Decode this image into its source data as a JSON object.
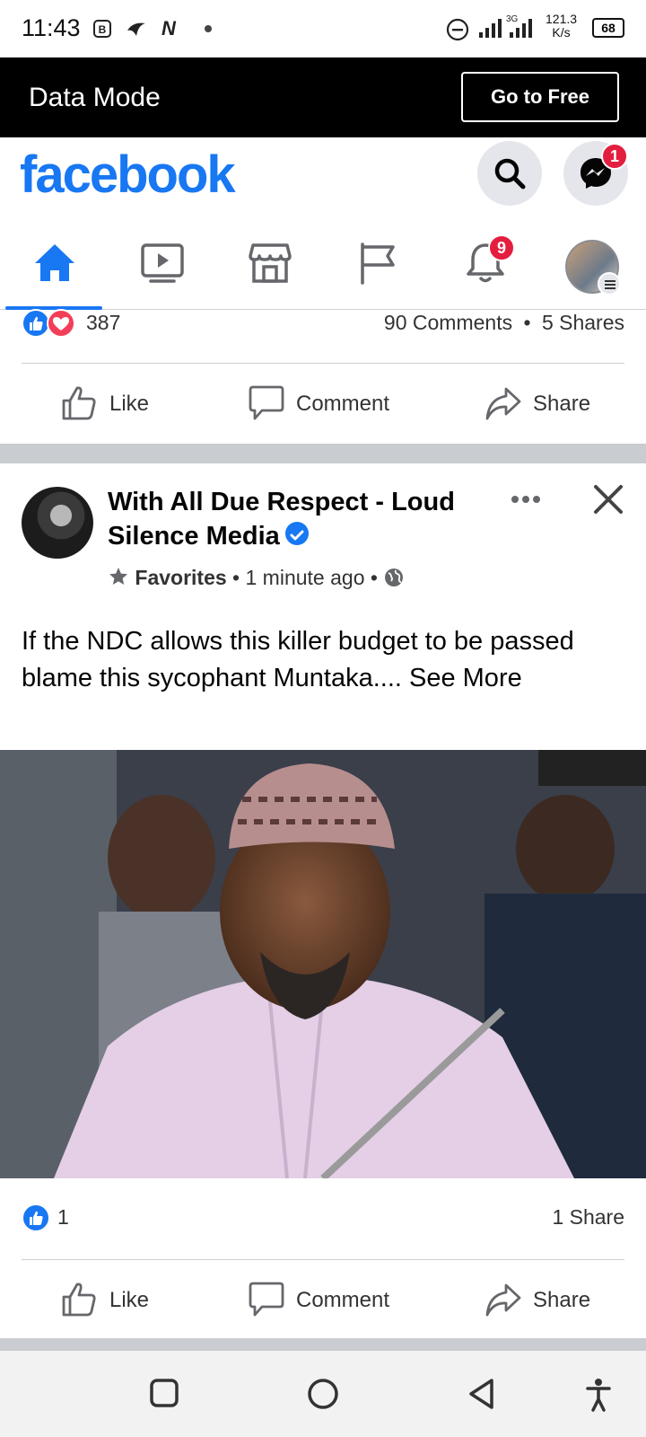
{
  "status_bar": {
    "time": "11:43",
    "speed": "121.3",
    "speed_unit": "K/s",
    "battery": "68",
    "network_label": "3G"
  },
  "data_banner": {
    "title": "Data Mode",
    "button_label": "Go to Free"
  },
  "header": {
    "logo": "facebook",
    "messenger_badge": "1"
  },
  "nav_tabs": {
    "active": "home",
    "notifications_badge": "9",
    "items": [
      "home-icon",
      "video-icon",
      "marketplace-icon",
      "pages-flag-icon",
      "notifications-bell-icon",
      "profile-menu"
    ]
  },
  "prev_post": {
    "reaction_count": "387",
    "comments": "90 Comments",
    "shares": "5 Shares",
    "dot": "•"
  },
  "actions": {
    "like": "Like",
    "comment": "Comment",
    "share": "Share"
  },
  "post": {
    "author": "With All Due Respect - Loud Silence Media",
    "verified": true,
    "favorites_label": "Favorites",
    "dot": "•",
    "time": "1 minute ago",
    "text": "If the NDC allows this killer budget to be passed blame this sycophant Muntaka.... See More",
    "reaction_count": "1",
    "shares": "1 Share"
  },
  "colors": {
    "brand": "#1877f2",
    "badge": "#e41e3f",
    "banner_bg": "#000000",
    "separator": "#c9ccd1"
  }
}
